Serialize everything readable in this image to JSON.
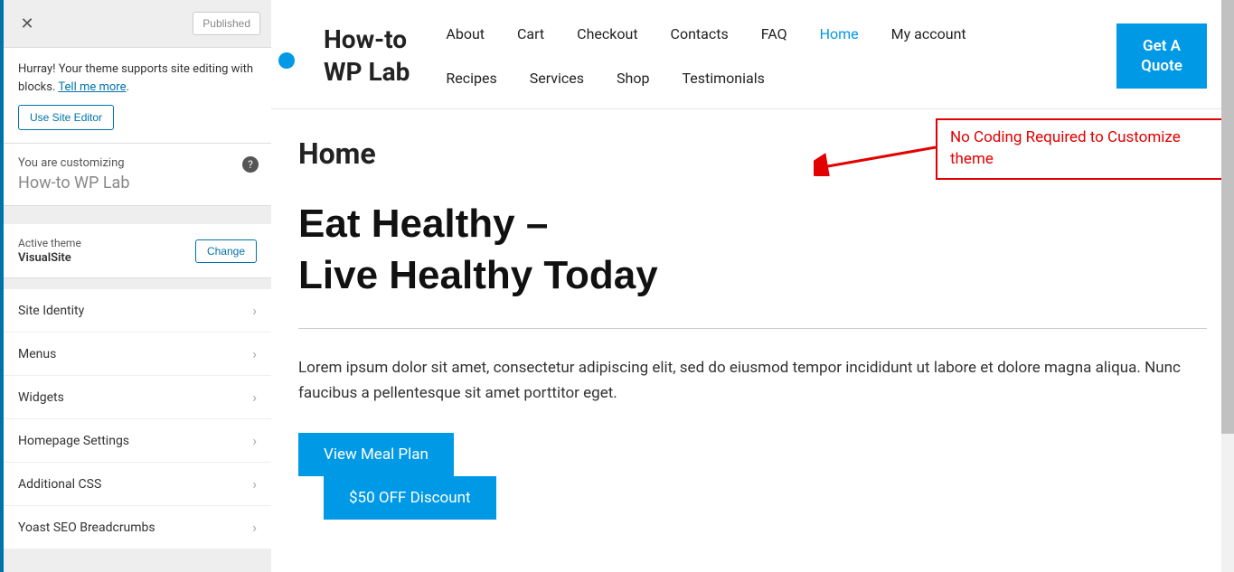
{
  "topbar": {
    "published_label": "Published"
  },
  "notice": {
    "text_prefix": "Hurray! Your theme supports site editing with blocks. ",
    "link_text": "Tell me more",
    "button_label": "Use Site Editor"
  },
  "customizing": {
    "label": "You are customizing",
    "site_name": "How-to WP Lab"
  },
  "theme": {
    "label": "Active theme",
    "name": "VisualSite",
    "change_label": "Change"
  },
  "menu_items": [
    "Site Identity",
    "Menus",
    "Widgets",
    "Homepage Settings",
    "Additional CSS",
    "Yoast SEO Breadcrumbs"
  ],
  "site": {
    "title": "How-to WP Lab",
    "nav_row1": [
      "About",
      "Cart",
      "Checkout",
      "Contacts",
      "FAQ",
      "Home",
      "My account"
    ],
    "nav_row2": [
      "Recipes",
      "Services",
      "Shop",
      "Testimonials"
    ],
    "active_nav": "Home",
    "quote_label": "Get A Quote"
  },
  "annotation": {
    "text": "No Coding Required to Customize theme"
  },
  "page": {
    "title": "Home",
    "hero_line1": "Eat Healthy –",
    "hero_line2": "Live Healthy Today",
    "body": "Lorem ipsum dolor sit amet, consectetur adipiscing elit, sed do eiusmod tempor incididunt ut labore et dolore magna aliqua. Nunc faucibus a pellentesque sit amet porttitor eget.",
    "cta1": "View Meal Plan",
    "cta2": "$50 OFF Discount"
  }
}
